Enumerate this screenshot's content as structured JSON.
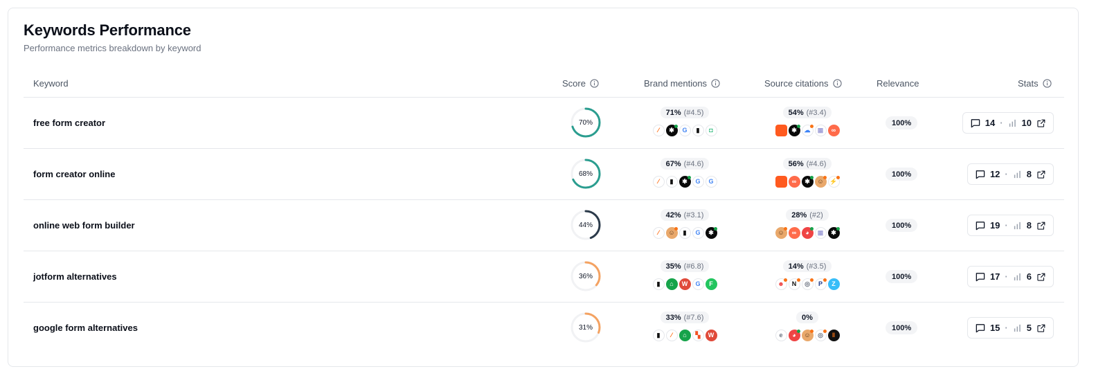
{
  "header": {
    "title": "Keywords Performance",
    "subtitle": "Performance metrics breakdown by keyword"
  },
  "columns": {
    "keyword": "Keyword",
    "score": "Score",
    "brand_mentions": "Brand mentions",
    "source_citations": "Source citations",
    "relevance": "Relevance",
    "stats": "Stats"
  },
  "rows": [
    {
      "keyword": "free form creator",
      "score": 70,
      "score_label": "70%",
      "score_color": "#2a9d8f",
      "brand_pct": "71%",
      "brand_rank": "(#4.5)",
      "brand_icons": [
        "jotform-icon",
        "asterisk-icon",
        "google-icon",
        "typeform-icon",
        "formstack-icon"
      ],
      "source_pct": "54%",
      "source_rank": "(#3.4)",
      "source_icons": [
        "orange-square-icon",
        "asterisk-icon",
        "cloud-icon",
        "grid-icon",
        "infinity-icon"
      ],
      "relevance": "100%",
      "comments": "14",
      "mentions": "10"
    },
    {
      "keyword": "form creator online",
      "score": 68,
      "score_label": "68%",
      "score_color": "#2a9d8f",
      "brand_pct": "67%",
      "brand_rank": "(#4.6)",
      "brand_icons": [
        "jotform-icon",
        "typeform-icon",
        "asterisk-icon",
        "google-icon",
        "google-icon"
      ],
      "source_pct": "56%",
      "source_rank": "(#4.6)",
      "source_icons": [
        "orange-square-icon",
        "infinity-icon",
        "asterisk-icon",
        "avatar-icon",
        "spark-icon"
      ],
      "relevance": "100%",
      "comments": "12",
      "mentions": "8"
    },
    {
      "keyword": "online web form builder",
      "score": 44,
      "score_label": "44%",
      "score_color": "#2b3a4a",
      "brand_pct": "42%",
      "brand_rank": "(#3.1)",
      "brand_icons": [
        "jotform-icon",
        "avatar-icon",
        "typeform-icon",
        "google-icon",
        "asterisk-icon"
      ],
      "source_pct": "28%",
      "source_rank": "(#2)",
      "source_icons": [
        "avatar-icon",
        "infinity-icon",
        "pie-icon",
        "grid-icon",
        "asterisk-icon"
      ],
      "relevance": "100%",
      "comments": "19",
      "mentions": "8"
    },
    {
      "keyword": "jotform alternatives",
      "score": 36,
      "score_label": "36%",
      "score_color": "#f4a261",
      "brand_pct": "35%",
      "brand_rank": "(#6.8)",
      "brand_icons": [
        "typeform-icon",
        "house-icon",
        "wufoo-icon",
        "google-icon",
        "formsite-icon"
      ],
      "source_pct": "14%",
      "source_rank": "(#3.5)",
      "source_icons": [
        "face-icon",
        "notion-icon",
        "search-icon",
        "paypal-icon",
        "zoho-icon"
      ],
      "relevance": "100%",
      "comments": "17",
      "mentions": "6"
    },
    {
      "keyword": "google form alternatives",
      "score": 31,
      "score_label": "31%",
      "score_color": "#f4a261",
      "brand_pct": "33%",
      "brand_rank": "(#7.6)",
      "brand_icons": [
        "typeform-icon",
        "jotform-icon",
        "house-icon",
        "microsoft-icon",
        "wufoo-icon"
      ],
      "source_pct": "0%",
      "source_rank": "",
      "source_icons": [
        "effy-icon",
        "pie-icon",
        "avatar-icon",
        "search-icon",
        "pause-icon"
      ],
      "relevance": "100%",
      "comments": "15",
      "mentions": "5"
    }
  ]
}
